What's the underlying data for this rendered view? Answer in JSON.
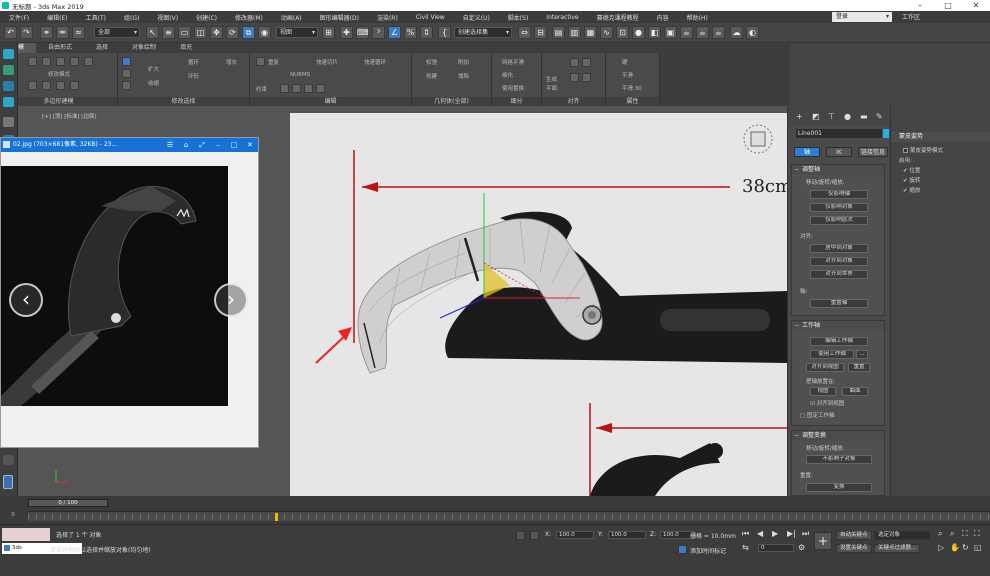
{
  "window": {
    "title": "无标题 - 3ds Max 2019"
  },
  "menu": {
    "items": [
      "文件(F)",
      "编辑(E)",
      "工具(T)",
      "组(G)",
      "视图(V)",
      "创建(C)",
      "修改器(M)",
      "动画(A)",
      "图形编辑器(D)",
      "渲染(R)",
      "Civil View",
      "自定义(U)",
      "脚本(S)",
      "Interactive",
      "赛德克课程教程",
      "内容",
      "帮助(H)"
    ],
    "login": "登录",
    "workspace": "工作区"
  },
  "toolbar": {
    "filter_dropdown": "全部",
    "view_dropdown": "视图",
    "selection_set": "创建选择集"
  },
  "ribbon": {
    "tabs": [
      "建模",
      "自由形式",
      "选择",
      "对象绘制",
      "填充"
    ],
    "active_tab": "建模",
    "groups": [
      {
        "label": "多边形建模",
        "mode": "修改模式"
      },
      {
        "label": "修改选择",
        "items": [
          "扩大",
          "收缩",
          "循环",
          "环形",
          "增长"
        ]
      },
      {
        "label": "编辑",
        "items": [
          "重复",
          "快速切片",
          "快速循环",
          "NURMS",
          "约束"
        ]
      },
      {
        "label": "几何体(全部)",
        "items": [
          "松弛",
          "创建",
          "附加",
          "塌陷"
        ]
      },
      {
        "label": "细分",
        "items": [
          "网格平滑",
          "细化",
          "使用置换"
        ]
      },
      {
        "label": "对齐",
        "items": [
          "生成",
          "平面"
        ]
      },
      {
        "label": "属性",
        "items": [
          "硬",
          "平滑",
          "平滑 30"
        ]
      }
    ]
  },
  "left_viewport": {
    "label": "[+] [顶] [标准] [边面]"
  },
  "image_viewer": {
    "title": "02.jpg (703×681像素, 32KB) - 23...",
    "prev_label": "‹",
    "next_label": "›"
  },
  "main_viewport": {
    "dimension_text": "38cm"
  },
  "command_panel": {
    "object_name": "Line001",
    "object_color": "#24b3e8",
    "sub_tabs": [
      "轴",
      "IK",
      "链接信息"
    ],
    "active_sub_tab": "轴",
    "adjust_pivot": {
      "header": "调整轴",
      "caption": "移动/旋转/缩放:",
      "buttons": [
        "仅影响轴",
        "仅影响对象",
        "仅影响层次"
      ],
      "align_label": "对齐:",
      "align_buttons": [
        "居中到对象",
        "对齐到对象",
        "对齐到世界"
      ],
      "pivot_label": "轴:",
      "reset_button": "重置轴"
    },
    "working_pivot": {
      "header": "工作轴",
      "edit_button": "编辑工作轴",
      "use_button": "使用工作轴",
      "align_view_button": "对齐到视图",
      "reset_button": "重置",
      "place_label": "把轴放置在:",
      "view_button": "视图",
      "surface_button": "曲面",
      "align_to_view_check": "对齐到视图",
      "fixed_label": "固定工作轴"
    },
    "adjust_transform": {
      "header": "调整变换",
      "caption": "移动/旋转/缩放:",
      "affect_button": "不影响子对象",
      "reset_label": "重置:",
      "transform_button": "变换"
    }
  },
  "far_right_panel": {
    "header": "蒙皮姿势",
    "mode_label": "蒙皮姿势模式",
    "enable_label": "启用:",
    "options": [
      "位置",
      "旋转",
      "缩放"
    ]
  },
  "timeline": {
    "frame_display": "0 / 100",
    "frame_start": "0"
  },
  "status": {
    "task_label": "选择了 1 个 对象",
    "prompt": "单击并拖动以选择并缩放对象(均匀地)",
    "taskbar_app": "3ds",
    "x_label": "X:",
    "x_value": "100.0",
    "y_label": "Y:",
    "y_value": "100.0",
    "z_label": "Z:",
    "z_value": "100.0",
    "grid_label": "栅格 = 10.0mm",
    "add_time_tag": "添加时间标记",
    "auto_key": "自动关键点",
    "set_key": "设置关键点",
    "selected_object": "选定对象",
    "key_filters": "关键点过滤器...",
    "frame_value": "0"
  }
}
